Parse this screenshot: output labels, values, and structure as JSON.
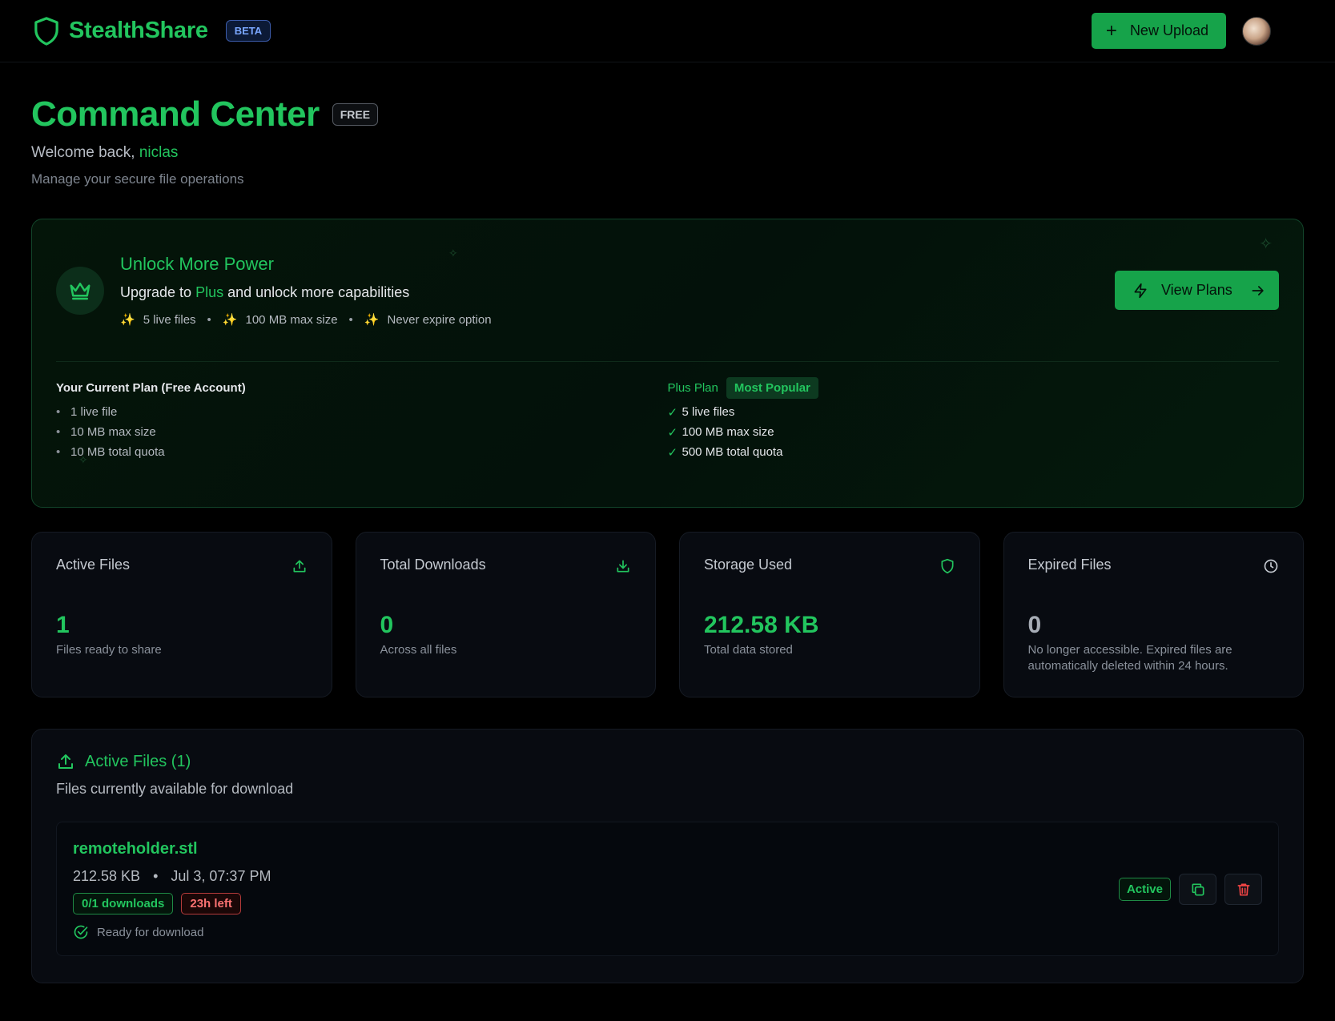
{
  "header": {
    "brand": "StealthShare",
    "beta_badge": "BETA",
    "new_upload_label": "New Upload"
  },
  "page": {
    "title": "Command Center",
    "plan_badge": "FREE",
    "welcome_prefix": "Welcome back,",
    "username": "niclas",
    "subtitle": "Manage your secure file operations"
  },
  "upgrade": {
    "title": "Unlock More Power",
    "line_prefix": "Upgrade to",
    "line_plan": "Plus",
    "line_suffix": "and unlock more capabilities",
    "perks": [
      "5 live files",
      "100 MB max size",
      "Never expire option"
    ],
    "view_plans_label": "View Plans",
    "current_plan": {
      "title": "Your Current Plan (Free Account)",
      "items": [
        "1 live file",
        "10 MB max size",
        "10 MB total quota"
      ]
    },
    "plus_plan": {
      "title": "Plus Plan",
      "badge": "Most Popular",
      "items": [
        "5 live files",
        "100 MB max size",
        "500 MB total quota"
      ]
    }
  },
  "stats": [
    {
      "label": "Active Files",
      "value": "1",
      "desc": "Files ready to share",
      "icon": "upload-icon"
    },
    {
      "label": "Total Downloads",
      "value": "0",
      "desc": "Across all files",
      "icon": "download-icon"
    },
    {
      "label": "Storage Used",
      "value": "212.58 KB",
      "desc": "Total data stored",
      "icon": "shield-icon"
    },
    {
      "label": "Expired Files",
      "value": "0",
      "desc": "No longer accessible. Expired files are automatically deleted within 24 hours.",
      "icon": "clock-icon"
    }
  ],
  "active_files": {
    "title": "Active Files (1)",
    "subtitle": "Files currently available for download",
    "items": [
      {
        "name": "remoteholder.stl",
        "size": "212.58 KB",
        "date": "Jul 3, 07:37 PM",
        "downloads": "0/1 downloads",
        "time_left": "23h left",
        "status_text": "Ready for download",
        "badge": "Active"
      }
    ]
  },
  "colors": {
    "accent": "#22c55e",
    "button": "#16a34a",
    "danger": "#f87171",
    "background": "#000000",
    "card": "#080b11"
  }
}
